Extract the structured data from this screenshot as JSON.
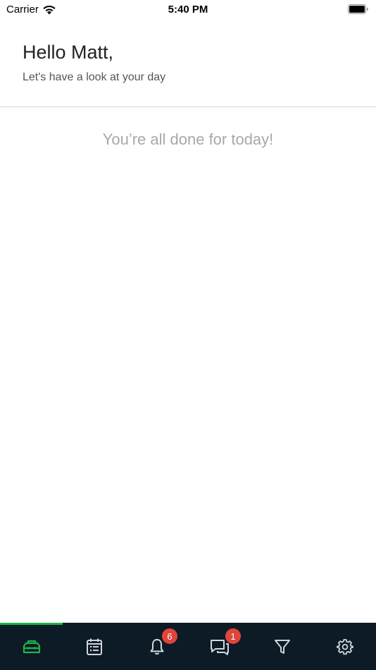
{
  "status_bar": {
    "carrier": "Carrier",
    "time": "5:40 PM"
  },
  "header": {
    "greeting": "Hello Matt,",
    "subtitle": "Let's have a look at your day"
  },
  "main": {
    "empty_message": "You’re all done for today!"
  },
  "tab_bar": {
    "active_tab": "home",
    "active_color": "#22b34a",
    "icon_color": "#d0d6dc",
    "background": "#0d1b27",
    "tabs": [
      {
        "id": "home",
        "icon": "toolbox-icon"
      },
      {
        "id": "schedule",
        "icon": "calendar-list-icon"
      },
      {
        "id": "notifications",
        "icon": "bell-icon",
        "badge": "6"
      },
      {
        "id": "messages",
        "icon": "chat-icon",
        "badge": "1"
      },
      {
        "id": "filter",
        "icon": "filter-icon"
      },
      {
        "id": "settings",
        "icon": "gear-icon"
      }
    ]
  }
}
